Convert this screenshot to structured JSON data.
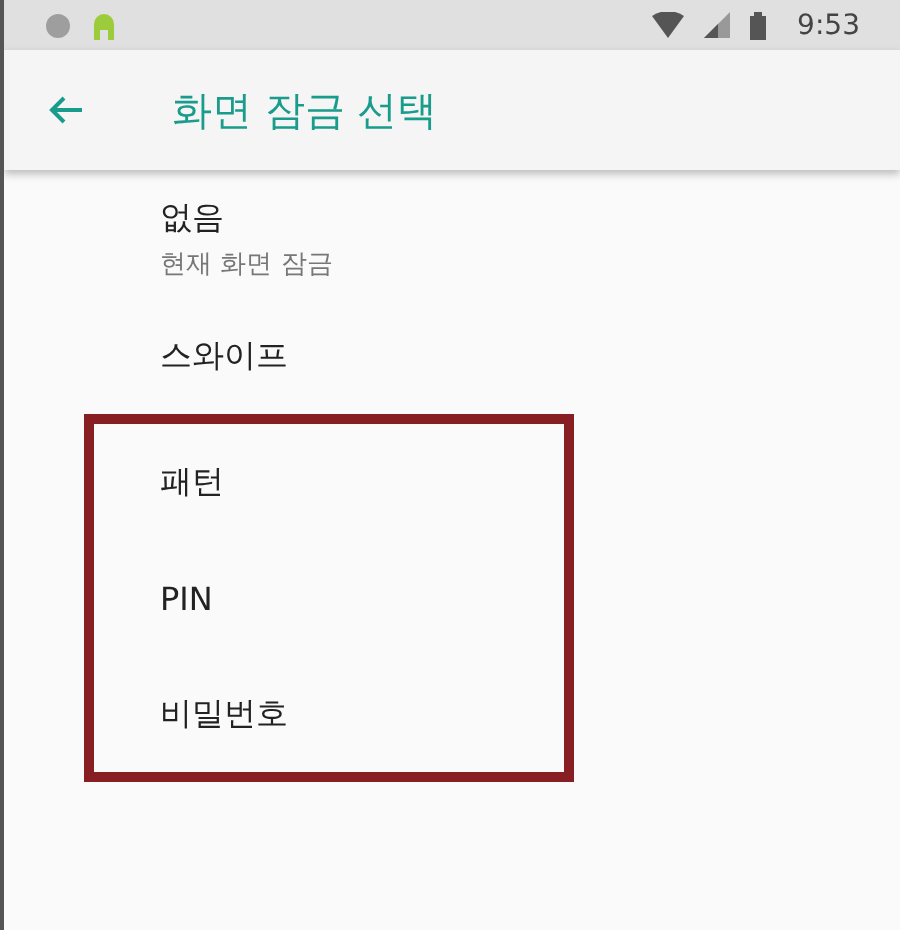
{
  "status_bar": {
    "time": "9:53"
  },
  "app_bar": {
    "title": "화면 잠금 선택"
  },
  "options": [
    {
      "title": "없음",
      "summary": "현재 화면 잠금",
      "highlighted": false
    },
    {
      "title": "스와이프",
      "highlighted": false
    },
    {
      "title": "패턴",
      "highlighted": true
    },
    {
      "title": "PIN",
      "highlighted": true
    },
    {
      "title": "비밀번호",
      "highlighted": true
    }
  ]
}
